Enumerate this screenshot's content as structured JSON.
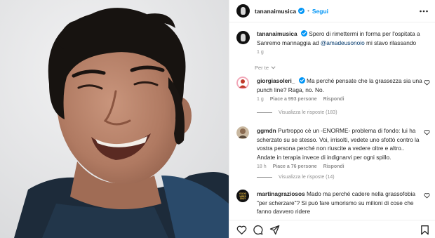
{
  "post": {
    "photo_alt": "",
    "header": {
      "username": "tananaimusica",
      "follow_label": "Segui",
      "separator": "•"
    },
    "caption": {
      "username": "tananaimusica",
      "text_before": "Spero di rimettermi in forma per l'ospitata a Sanremo mannaggia ad ",
      "mention": "@amadeusonoio",
      "text_after": " mi stavo rilassando",
      "time": "1 g"
    },
    "filter_label": "Per te"
  },
  "comments": [
    {
      "username": "giorgiasoleri_",
      "verified": true,
      "text": "Ma perché pensate che la grassezza sia una punch line? Raga, no. No.",
      "time": "1 g",
      "likes": "Piace a 993 persone",
      "reply_label": "Rispondi",
      "view_replies": "Visualizza le risposte (183)"
    },
    {
      "username": "ggmdn",
      "verified": false,
      "text": "Purtroppo cè un -ENORME- problema di fondo: lui ha scherzato su se stesso. Voi, irrisolti, vedete uno sfottò contro la vostra persona perché non riuscite a vedere oltre e altro.. Andate in terapia invece di indignarvi per ogni spillo.",
      "time": "18 h",
      "likes": "Piace a 76 persone",
      "reply_label": "Rispondi",
      "view_replies": "Visualizza le risposte (14)"
    },
    {
      "username": "martinagraziosos",
      "verified": false,
      "text": "Mado ma perché cadere nella grassofobia \"per scherzare\"? Si può fare umorismo su milioni di cose che fanno davvero ridere",
      "avatar_text": "GOOD VIBES ONLY"
    }
  ],
  "icons": {
    "more": "more-horizontal-icon",
    "verified": "verified-badge-icon",
    "heart": "heart-icon",
    "comment": "comment-icon",
    "share": "share-icon",
    "save": "bookmark-icon",
    "chevron": "chevron-down-icon"
  },
  "colors": {
    "link": "#0095f6",
    "mention": "#00376b",
    "muted": "#8e8e8e",
    "text": "#262626"
  }
}
